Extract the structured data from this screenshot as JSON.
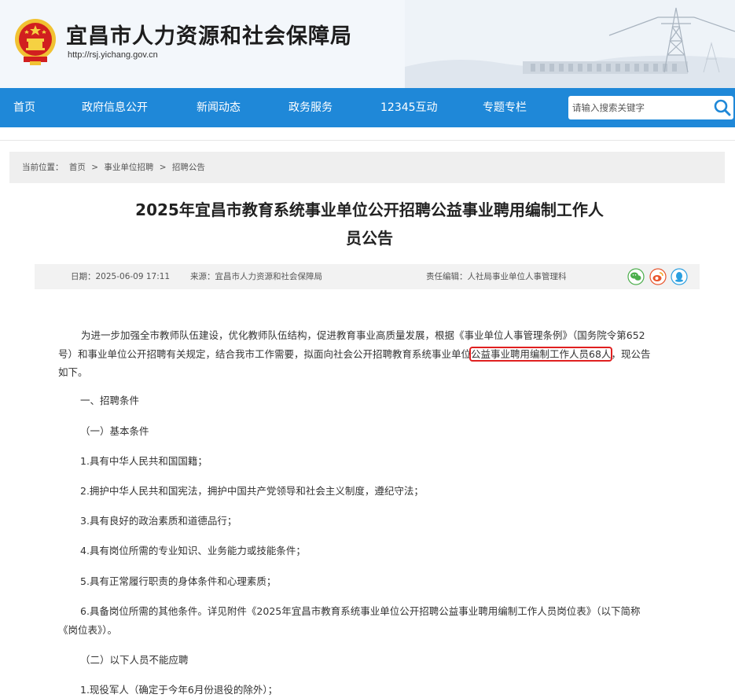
{
  "header": {
    "site_title": "宜昌市人力资源和社会保障局",
    "site_url": "http://rsj.yichang.gov.cn",
    "emblem_icon": "national-emblem-icon"
  },
  "nav": {
    "items": [
      "首页",
      "政府信息公开",
      "新闻动态",
      "政务服务",
      "12345互动",
      "专题专栏"
    ],
    "search_placeholder": "请输入搜索关键字",
    "search_icon": "search-icon",
    "bg_color": "#1f88d8"
  },
  "breadcrumb": {
    "label": "当前位置：",
    "items": [
      "首页",
      "事业单位招聘",
      "招聘公告"
    ],
    "separator": ">"
  },
  "article": {
    "title_line1": "2025年宜昌市教育系统事业单位公开招聘公益事业聘用编制工作人",
    "title_line2": "员公告",
    "date": "日期：2025-06-09 17:11",
    "source": "来源：宜昌市人力资源和社会保障局",
    "editor": "责任编辑：人社局事业单位人事管理科",
    "share_icons": [
      "wechat-icon",
      "weibo-icon",
      "qq-icon"
    ],
    "intro_line1": "为进一步加强全市教师队伍建设，优化教师队伍结构，促进教育事业高质量发展，根据《事业单位人事管理条例》（国务院令第652",
    "intro_line2_a": "号）和事业单位公开招聘有关规定，结合我市工作需要，拟面向社会公开招聘教育系统事业单位",
    "intro_line2_highlight": "公益事业聘用编制工作人员68人",
    "intro_line2_b": "，现公告",
    "intro_line3": "如下。",
    "section1": "一、招聘条件",
    "sub1": "（一）基本条件",
    "c1": "1.具有中华人民共和国国籍；",
    "c2": "2.拥护中华人民共和国宪法，拥护中国共产党领导和社会主义制度，遵纪守法；",
    "c3": "3.具有良好的政治素质和道德品行；",
    "c4": "4.具有岗位所需的专业知识、业务能力或技能条件；",
    "c5": "5.具有正常履行职责的身体条件和心理素质；",
    "c6_line1": "6.具备岗位所需的其他条件。详见附件《2025年宜昌市教育系统事业单位公开招聘公益事业聘用编制工作人员岗位表》（以下简称",
    "c6_line2": "《岗位表》）。",
    "sub2": "（二）以下人员不能应聘",
    "d1": "1.现役军人（确定于今年6月份退役的除外）；"
  }
}
